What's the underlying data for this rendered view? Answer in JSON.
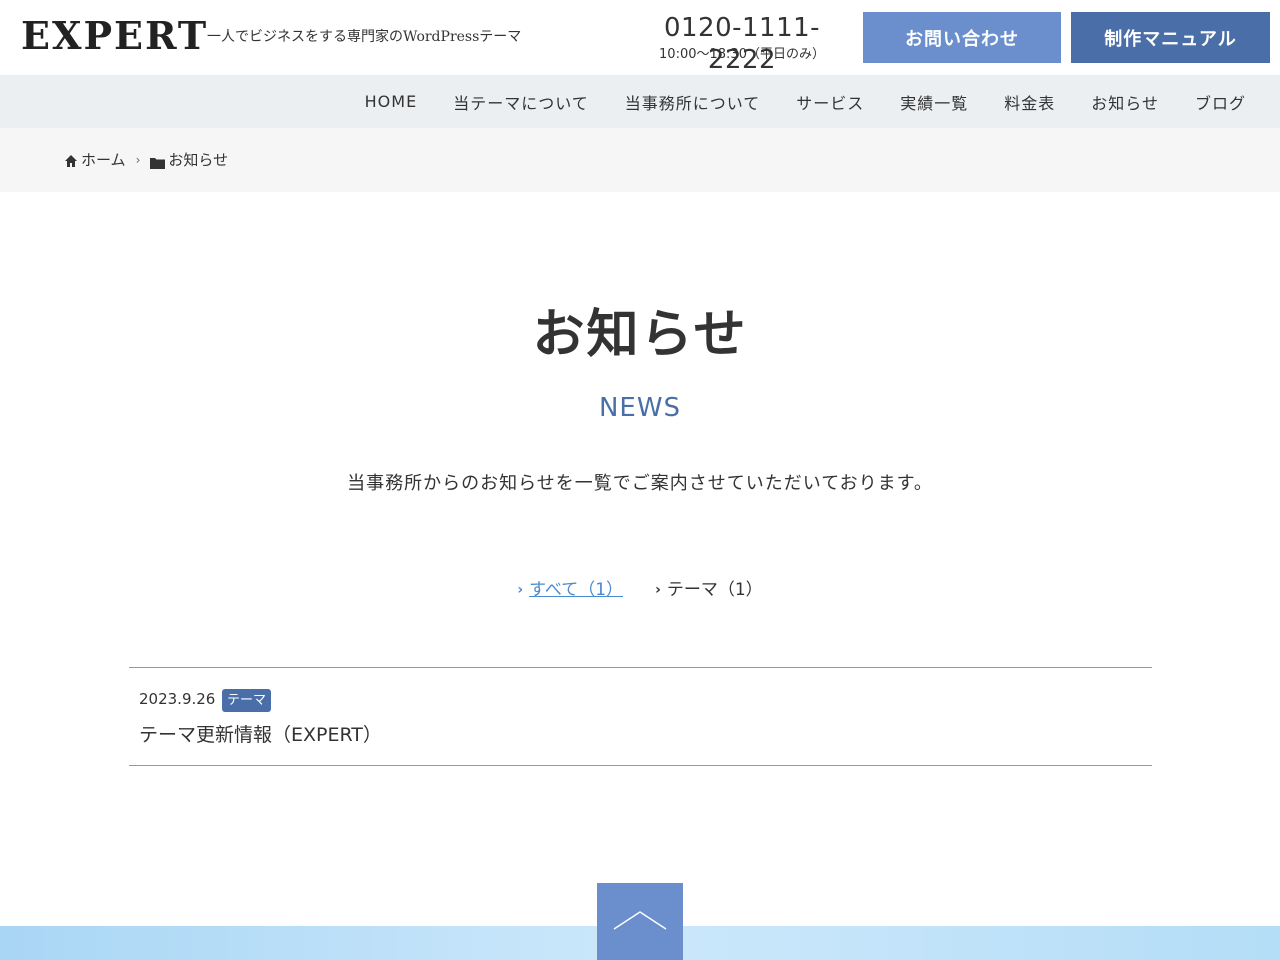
{
  "header": {
    "logo": "EXPERT",
    "tagline": "一人でビジネスをする専門家のWordPressテーマ",
    "tel": "0120-1111-2222",
    "hours": "10:00～18:30（平日のみ）",
    "contact_button": "お問い合わせ",
    "manual_button": "制作マニュアル"
  },
  "nav": {
    "items": [
      {
        "label": "HOME"
      },
      {
        "label": "当テーマについて"
      },
      {
        "label": "当事務所について"
      },
      {
        "label": "サービス"
      },
      {
        "label": "実績一覧"
      },
      {
        "label": "料金表"
      },
      {
        "label": "お知らせ"
      },
      {
        "label": "ブログ"
      }
    ]
  },
  "breadcrumb": {
    "home": "ホーム",
    "separator": "›",
    "current": "お知らせ",
    "home_icon": "home-icon",
    "folder_icon": "folder-icon"
  },
  "main": {
    "title": "お知らせ",
    "subtitle": "NEWS",
    "description": "当事務所からのお知らせを一覧でご案内させていただいております。",
    "filters": [
      {
        "label": "すべて（1）",
        "active": true
      },
      {
        "label": "テーマ（1）",
        "active": false
      }
    ],
    "filter_chevron": "›",
    "news": [
      {
        "date": "2023.9.26",
        "tag": "テーマ",
        "title": "テーマ更新情報（EXPERT）"
      }
    ]
  },
  "pagetop": {
    "icon": "chevron-up-icon"
  },
  "colors": {
    "accent": "#4a6fa8",
    "button_light": "#6a8fcc",
    "link": "#4a8ad0",
    "nav_bg": "#eceff2"
  }
}
